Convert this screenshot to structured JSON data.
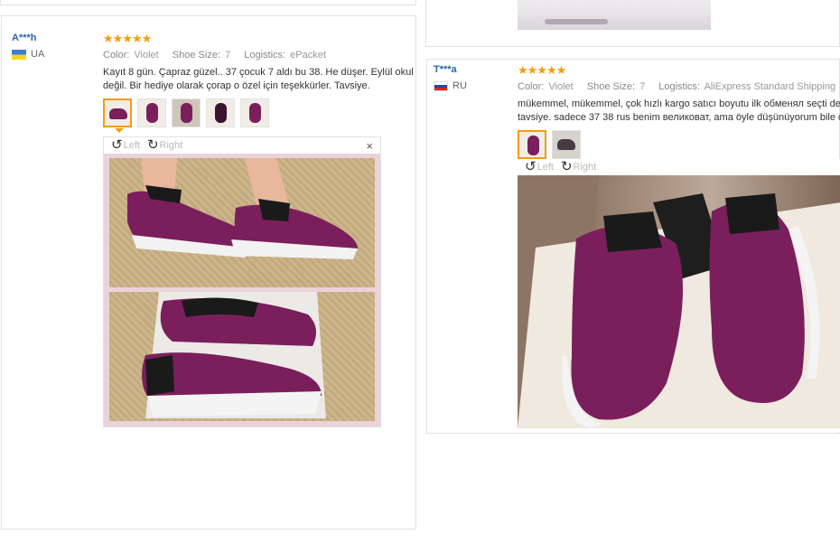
{
  "reviews": [
    {
      "user": "A***h",
      "country": "UA",
      "stars": "★★★★★",
      "color_label": "Color:",
      "color": "Violet",
      "size_label": "Shoe Size:",
      "size": "7",
      "logistics_label": "Logistics:",
      "logistics": "ePacket",
      "text_line1": "Kayıt 8 gün. Çapraz güzel.. 37 çocuk 7 aldı bu 38. He düşer. Eylül okul bi",
      "text_line2": "değil. Bir hediye olarak çorap o özel için teşekkürler. Tavsiye.",
      "viewer_left": "Left",
      "viewer_right": "Right",
      "viewer_close": "×"
    },
    {
      "user": "T***a",
      "country": "RU",
      "stars": "★★★★★",
      "color_label": "Color:",
      "color": "Violet",
      "size_label": "Shoe Size:",
      "size": "7",
      "logistics_label": "Logistics:",
      "logistics": "AliExpress Standard Shipping",
      "text_line1": "mükemmel, mükemmel, çok hızlı kargo satıcı boyutu ilk обменял seçti değil, bo",
      "text_line2": "tavsiye. sadece 37 38 rus benim великоват, ama öyle düşünüyorum bile daha i",
      "viewer_left": "Left",
      "viewer_right": "Right"
    }
  ],
  "icons": {
    "rotate_left": "↺",
    "rotate_right": "↻"
  },
  "colors": {
    "username": "#2b66a8",
    "star": "#f39c12",
    "shoe": "#7a1f5c"
  }
}
